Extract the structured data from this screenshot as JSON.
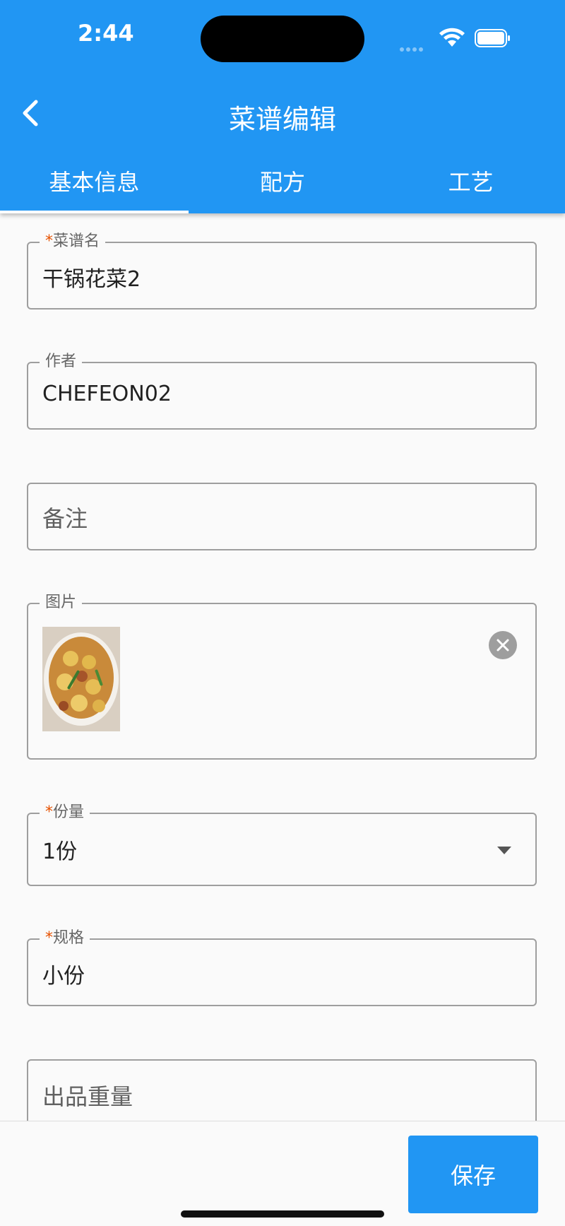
{
  "status_bar": {
    "time": "2:44"
  },
  "header": {
    "title": "菜谱编辑"
  },
  "tabs": [
    {
      "label": "基本信息",
      "active": true
    },
    {
      "label": "配方",
      "active": false
    },
    {
      "label": "工艺",
      "active": false
    }
  ],
  "form": {
    "recipe_name": {
      "required_mark": "*",
      "label": "菜谱名",
      "value": "干锅花菜2"
    },
    "author": {
      "label": "作者",
      "value": "CHEFEON02"
    },
    "notes": {
      "placeholder": "备注"
    },
    "image": {
      "label": "图片"
    },
    "portion": {
      "required_mark": "*",
      "label": "份量",
      "value": "1份"
    },
    "spec": {
      "required_mark": "*",
      "label": "规格",
      "value": "小份"
    },
    "output_weight": {
      "placeholder": "出品重量"
    }
  },
  "footer": {
    "save_label": "保存"
  },
  "colors": {
    "primary": "#2196f3",
    "required": "#e65100",
    "border": "#9e9e9e"
  }
}
